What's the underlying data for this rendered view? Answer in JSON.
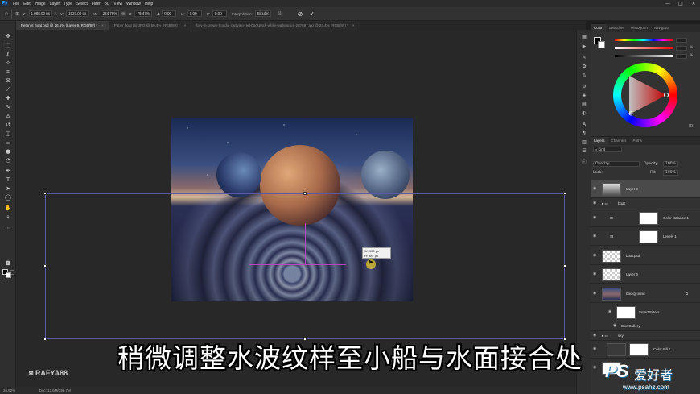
{
  "app": {
    "logo": "Ps",
    "menu": [
      "File",
      "Edit",
      "Image",
      "Layer",
      "Type",
      "Select",
      "Filter",
      "3D",
      "View",
      "Window",
      "Help"
    ],
    "window_controls": [
      "—",
      "□",
      "✕"
    ]
  },
  "options_bar": {
    "x_label": "X:",
    "x_value": "1,088.00 px",
    "y_label": "Y:",
    "y_value": "1537.00 px",
    "w_label": "W:",
    "w_value": "224.76%",
    "h_label": "H:",
    "h_value": "79.47%",
    "angle_value": "0.00",
    "hskew_label": "H:",
    "hskew_value": "0.00",
    "vskew_label": "V:",
    "vskew_value": "0.00",
    "interp_label": "Interpolation:",
    "interp_value": "Bicubic",
    "cancel_icon": "cancel-icon",
    "commit_icon": "check-icon"
  },
  "tabs": [
    {
      "label": "Petanet Boat.psd @ 26.5% (Layer 9, RGB/8#) *",
      "active": true
    },
    {
      "label": "Paper boat (6).JPG @ 50.4% (RGB/8#) *",
      "active": false
    },
    {
      "label": "boy-in-brown-hoodie-carrying-red-backpack-while-walking-on-287697.jpg @ 24.4% (RGB/8#) *",
      "active": false
    }
  ],
  "transform_tooltip": {
    "line1": "W: 130 px",
    "line2": "H: 387 px"
  },
  "status": {
    "zoom": "26.52%",
    "doc": "Doc: 13.6M/198.7M"
  },
  "color_panel": {
    "tabs": [
      "Color",
      "Swatches",
      "Gradients",
      "Patterns"
    ],
    "tabs_shown": [
      "Color",
      "Swatches",
      "Histogram",
      "Navigator"
    ],
    "units": [
      "%",
      "%",
      "%"
    ]
  },
  "layers_panel": {
    "tabs": [
      "Layers",
      "Channels",
      "Paths"
    ],
    "blend_mode": "Overlay",
    "opacity_label": "Opacity:",
    "opacity_value": "100%",
    "lock_label": "Lock:",
    "fill_label": "Fill:",
    "fill_value": "100%",
    "layers": [
      {
        "name": "Layer 9"
      },
      {
        "name": "boat"
      },
      {
        "name": "Color Balance 1"
      },
      {
        "name": "Levels 1"
      },
      {
        "name": "boat.psd"
      },
      {
        "name": "Layer 6"
      },
      {
        "name": "background"
      },
      {
        "name": "Smart Filters"
      },
      {
        "name": "Blur Gallery"
      },
      {
        "name": "sky"
      },
      {
        "name": "Color Fill 1"
      }
    ]
  },
  "subtitle": "稍微调整水波纹样至小船与水面接合处",
  "watermark_instagram": "RAFYA88",
  "watermark_site": {
    "logo": "PS",
    "cn": "爱好者",
    "url": "www.psahz.com"
  }
}
